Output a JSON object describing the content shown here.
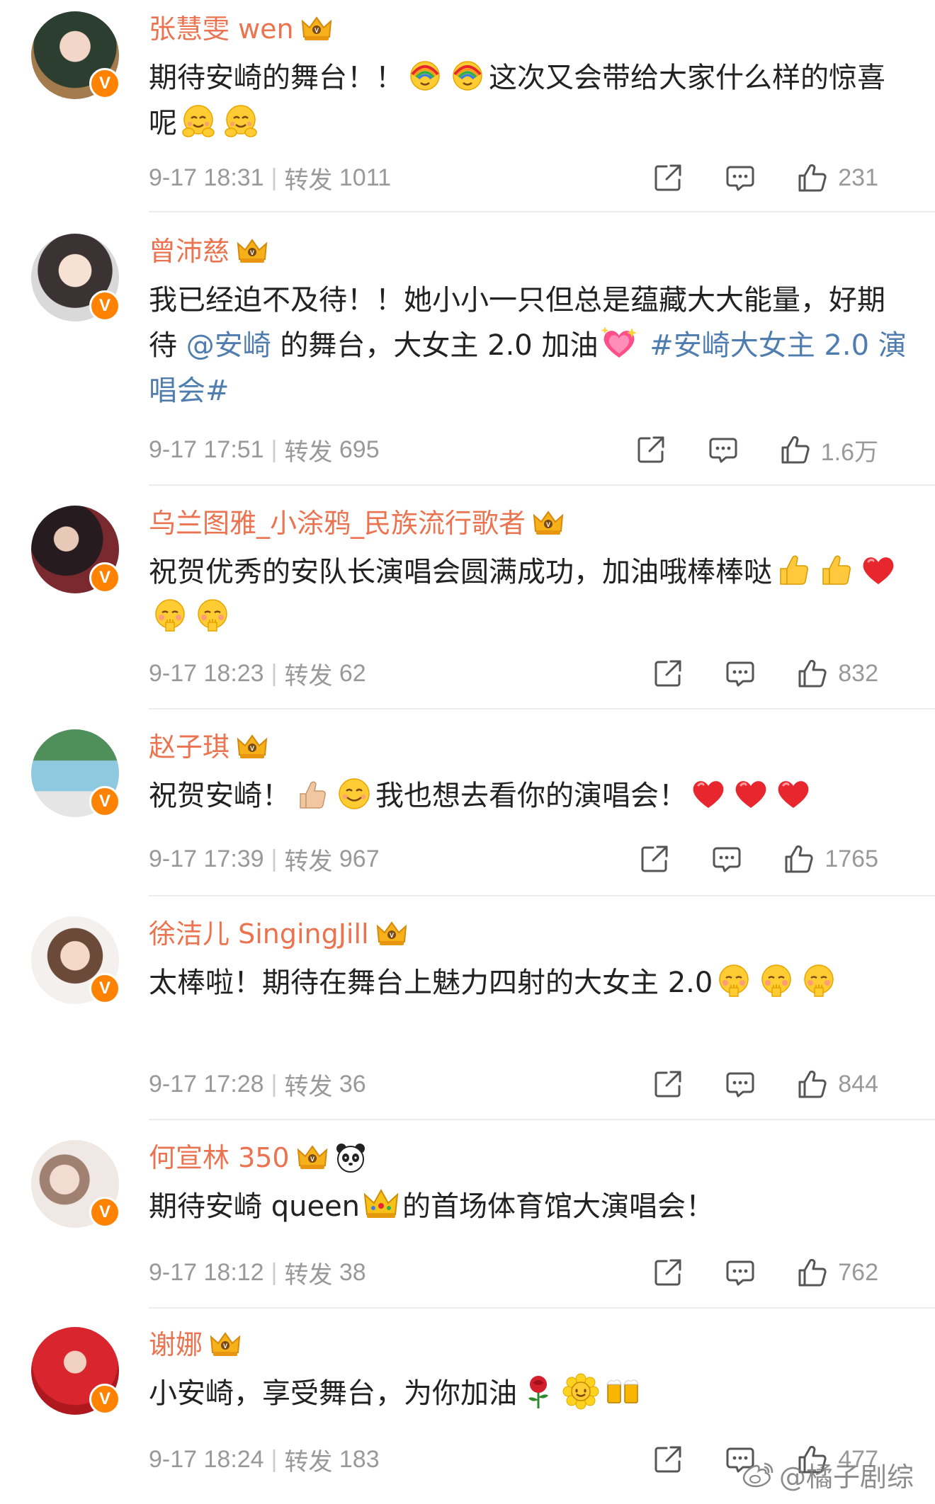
{
  "colors": {
    "name": "#eb7350",
    "link": "#507daf",
    "meta": "#999999",
    "badge": "#ff8200",
    "divider": "#ececec"
  },
  "labels": {
    "repost": "转发"
  },
  "comments": [
    {
      "name": "张慧雯 wen",
      "avatar_bg": "#3c5a48",
      "text_parts": [
        "期待安崎的舞台！！",
        "[emoji:rainbow-hug]",
        "[emoji:rainbow-hug]",
        "这次又会带给大家什么样的惊喜呢",
        "[emoji:hug]",
        "[emoji:hug]"
      ],
      "date": "9-17 18:31",
      "reposts": "1011",
      "likes": "231"
    },
    {
      "name": "曾沛慈",
      "avatar_bg": "#cfd3d8",
      "text_before": "我已经迫不及待！！她小小一只但总是蕴藏大大能量，好期待 ",
      "mention": "@安崎",
      "text_after": " 的舞台，大女主 2.0 加油",
      "hashtag": "#安崎大女主 2.0 演唱会#",
      "date": "9-17 17:51",
      "reposts": "695",
      "likes": "1.6万"
    },
    {
      "name": "乌兰图雅_小涂鸦_民族流行歌者",
      "avatar_bg": "#3a2a2e",
      "text": "祝贺优秀的安队长演唱会圆满成功，加油哦棒棒哒",
      "date": "9-17 18:23",
      "reposts": "62",
      "likes": "832"
    },
    {
      "name": "赵子琪",
      "avatar_bg": "#5c8f6a",
      "text_a": "祝贺安崎！",
      "text_b": "我也想去看你的演唱会！",
      "date": "9-17 17:39",
      "reposts": "967",
      "likes": "1765"
    },
    {
      "name": "徐洁儿 SingingJill",
      "avatar_bg": "#f3e6e0",
      "text": "太棒啦！期待在舞台上魅力四射的大女主 2.0",
      "date": "9-17 17:28",
      "reposts": "36",
      "likes": "844"
    },
    {
      "name": "何宣林 350",
      "avatar_bg": "#e9e4e2",
      "text_a": "期待安崎 queen",
      "text_b": "的首场体育馆大演唱会！",
      "date": "9-17 18:12",
      "reposts": "38",
      "likes": "762"
    },
    {
      "name": "谢娜",
      "avatar_bg": "#c8202a",
      "text": "小安崎，享受舞台，为你加油",
      "date": "9-17 18:24",
      "reposts": "183",
      "likes": "477"
    }
  ],
  "watermark": "@橘子剧综"
}
